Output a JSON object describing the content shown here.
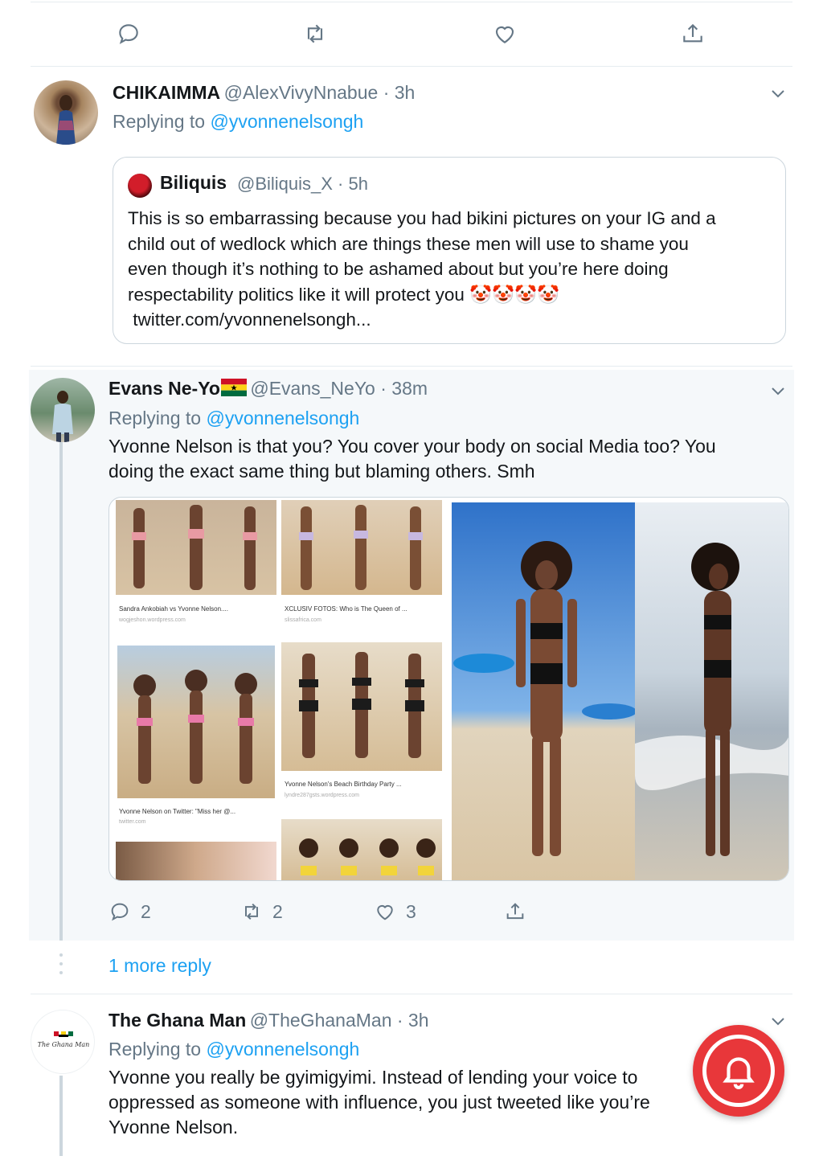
{
  "colors": {
    "accent": "#1da1f2",
    "secondary_text": "#657786",
    "border": "#e6ecf0",
    "notification_red": "#e8373a"
  },
  "top_actions": [
    "reply-icon",
    "retweet-icon",
    "like-icon",
    "share-icon"
  ],
  "tweet1": {
    "name": "CHIKAIMMA",
    "handle_time": "@AlexVivyNnabue · 3h",
    "replying_prefix": "Replying to",
    "replying_handle": "@yvonnenelsongh",
    "quote": {
      "name": "Biliquis",
      "handle_time": "@Biliquis_X · 5h",
      "lines": [
        "This is so embarrassing because you had bikini pictures on your IG and a",
        "child out of wedlock which are things these men will use to shame you",
        "even though it’s nothing to be ashamed about but you’re here doing",
        "respectability politics like it will protect you 🤡🤡🤡🤡",
        " twitter.com/yvonnenelsongh..."
      ]
    }
  },
  "tweet2": {
    "name": "Evans Ne-Yo",
    "flag": "ghana-flag",
    "handle_time": "@Evans_NeYo · 38m",
    "replying_prefix": "Replying to",
    "replying_handle": "@yvonnenelsongh",
    "lines": [
      "Yvonne Nelson is that you? You cover your body on social Media too? You",
      "doing the exact same thing but blaming others. Smh"
    ],
    "media_captions": [
      {
        "title": "Sandra Ankobiah vs Yvonne Nelson....",
        "source": "wogjeshon.wordpress.com"
      },
      {
        "title": "XCLUSIV FOTOS: Who is The Queen of ...",
        "source": "slissafrica.com"
      },
      {
        "title": "Yvonne Nelson on Twitter: \"Miss her @...",
        "source": "twitter.com"
      },
      {
        "title": "Yvonne Nelson's Beach Birthday Party ...",
        "source": "lyndre287gsts.wordpress.com"
      }
    ],
    "stats": {
      "replies": "2",
      "retweets": "2",
      "likes": "3"
    }
  },
  "more_reply": "1 more reply",
  "tweet3": {
    "name": "The Ghana Man",
    "avatar_text": "The Ghana Man",
    "handle_time": "@TheGhanaMan · 3h",
    "replying_prefix": "Replying to",
    "replying_handle": "@yvonnenelsongh",
    "lines": [
      "Yvonne you really be gyimigyimi. Instead of lending your voice to",
      "oppressed as someone with influence, you just tweeted like you’re",
      "Yvonne Nelson."
    ]
  }
}
